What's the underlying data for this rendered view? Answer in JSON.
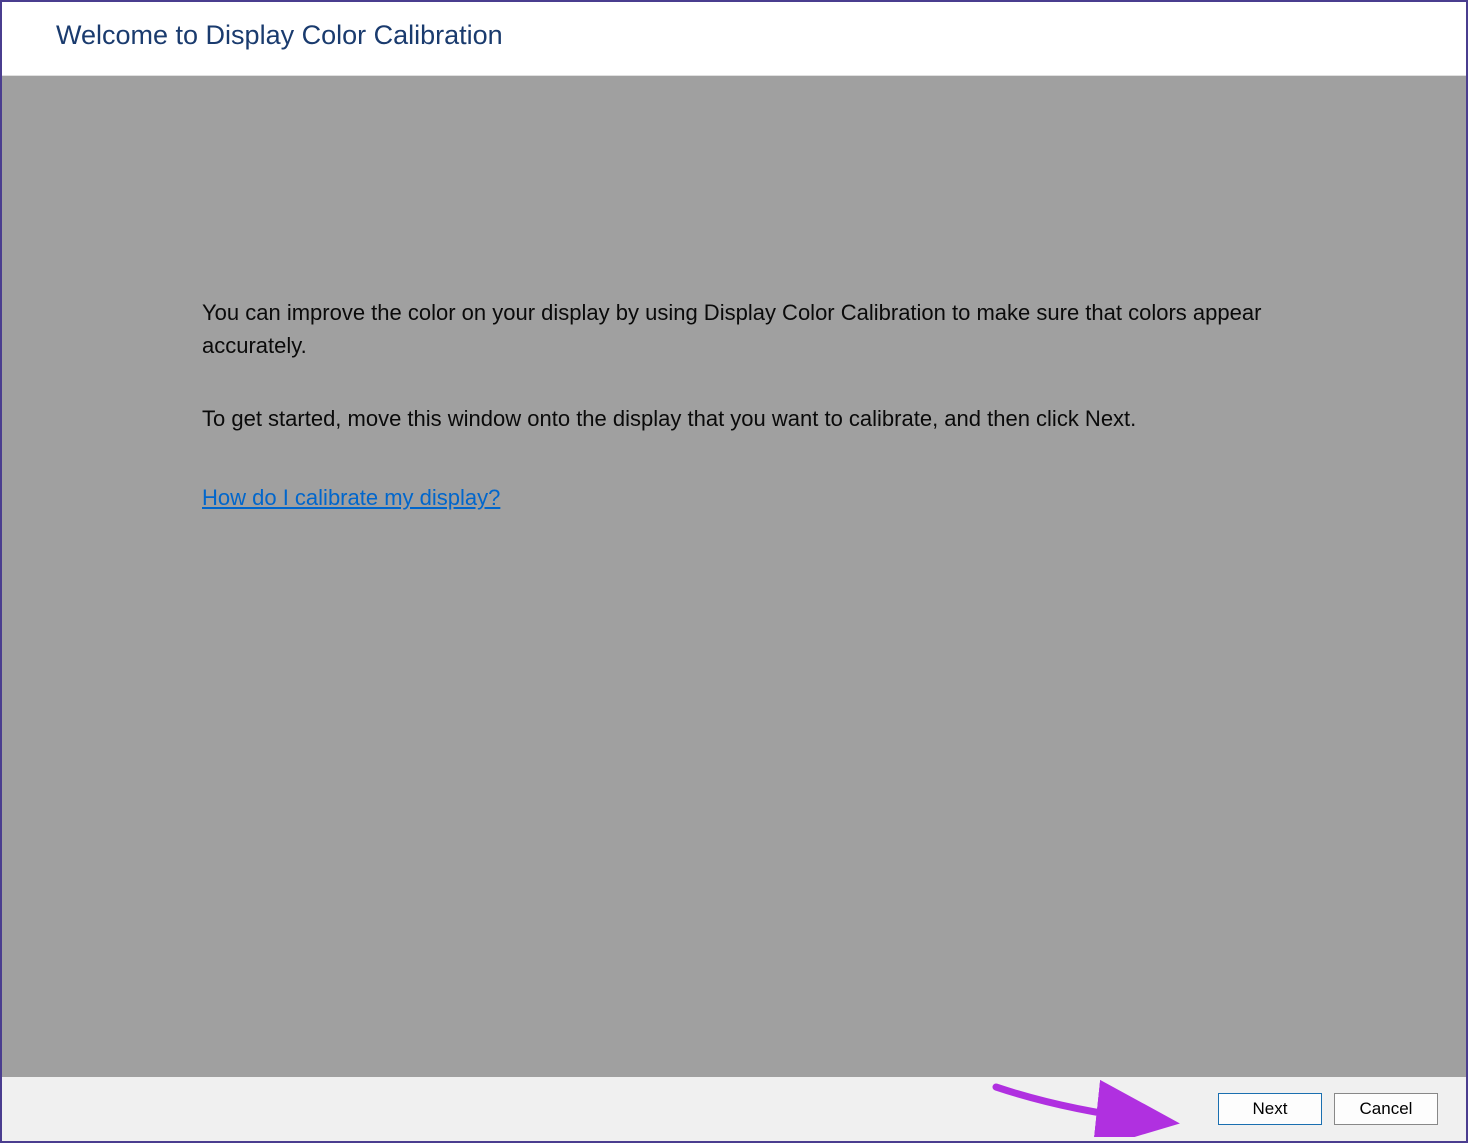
{
  "header": {
    "title": "Welcome to Display Color Calibration"
  },
  "content": {
    "paragraph1": "You can improve the color on your display by using Display Color Calibration to make sure that colors appear accurately.",
    "paragraph2": "To get started, move this window onto the display that you want to calibrate, and then click Next.",
    "help_link": "How do I calibrate my display?"
  },
  "footer": {
    "next_label": "Next",
    "cancel_label": "Cancel"
  },
  "annotation": {
    "arrow_color": "#b030e0"
  }
}
